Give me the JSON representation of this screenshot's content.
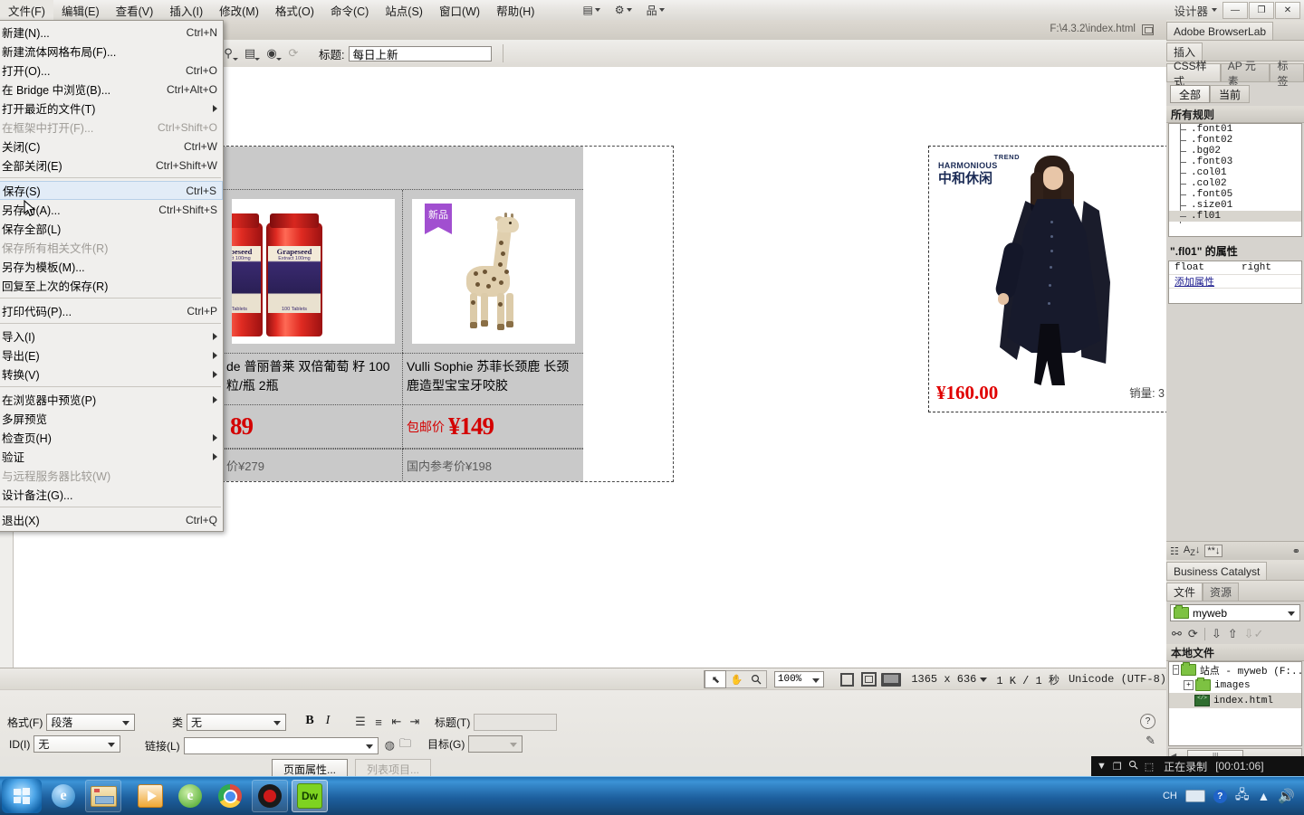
{
  "menubar": {
    "items": [
      {
        "label": "文件(F)",
        "active": true
      },
      {
        "label": "编辑(E)"
      },
      {
        "label": "查看(V)"
      },
      {
        "label": "插入(I)"
      },
      {
        "label": "修改(M)"
      },
      {
        "label": "格式(O)"
      },
      {
        "label": "命令(C)"
      },
      {
        "label": "站点(S)"
      },
      {
        "label": "窗口(W)"
      },
      {
        "label": "帮助(H)"
      }
    ],
    "layout_icon": "▤",
    "settings_icon": "⚙",
    "extend_icon": "品",
    "workspace_label": "设计器",
    "win_minimize": "—",
    "win_restore": "❐",
    "win_close": "✕"
  },
  "file_menu": {
    "items": [
      {
        "label": "新建(N)...",
        "shortcut": "Ctrl+N"
      },
      {
        "label": "新建流体网格布局(F)...",
        "shortcut": ""
      },
      {
        "label": "打开(O)...",
        "shortcut": "Ctrl+O"
      },
      {
        "label": "在 Bridge 中浏览(B)...",
        "shortcut": "Ctrl+Alt+O"
      },
      {
        "label": "打开最近的文件(T)",
        "shortcut": "",
        "submenu": true
      },
      {
        "label": "在框架中打开(F)...",
        "shortcut": "Ctrl+Shift+O",
        "disabled": true
      },
      {
        "label": "关闭(C)",
        "shortcut": "Ctrl+W"
      },
      {
        "label": "全部关闭(E)",
        "shortcut": "Ctrl+Shift+W"
      },
      {
        "separator": true
      },
      {
        "label": "保存(S)",
        "shortcut": "Ctrl+S",
        "highlight": true
      },
      {
        "label": "另存为(A)...",
        "shortcut": "Ctrl+Shift+S"
      },
      {
        "label": "保存全部(L)",
        "shortcut": ""
      },
      {
        "label": "保存所有相关文件(R)",
        "shortcut": "",
        "disabled": true
      },
      {
        "label": "另存为模板(M)...",
        "shortcut": ""
      },
      {
        "label": "回复至上次的保存(R)",
        "shortcut": ""
      },
      {
        "separator": true
      },
      {
        "label": "打印代码(P)...",
        "shortcut": "Ctrl+P"
      },
      {
        "separator": true
      },
      {
        "label": "导入(I)",
        "shortcut": "",
        "submenu": true
      },
      {
        "label": "导出(E)",
        "shortcut": "",
        "submenu": true
      },
      {
        "label": "转换(V)",
        "shortcut": "",
        "submenu": true
      },
      {
        "separator": true
      },
      {
        "label": "在浏览器中预览(P)",
        "shortcut": "",
        "submenu": true
      },
      {
        "label": "多屏预览",
        "shortcut": ""
      },
      {
        "label": "检查页(H)",
        "shortcut": "",
        "submenu": true
      },
      {
        "label": "验证",
        "shortcut": "",
        "submenu": true
      },
      {
        "label": "与远程服务器比较(W)",
        "shortcut": "",
        "disabled": true
      },
      {
        "label": "设计备注(G)...",
        "shortcut": ""
      },
      {
        "separator": true
      },
      {
        "label": "退出(X)",
        "shortcut": "Ctrl+Q"
      }
    ]
  },
  "document": {
    "file_path": "F:\\4.3.2\\index.html",
    "toolbar": {
      "title_label": "标题:",
      "title_value": "每日上新",
      "buttons": [
        "code-nav-icon",
        "visual-aids-icon",
        "live-view-icon",
        "refresh-icon"
      ]
    }
  },
  "page": {
    "products": [
      {
        "badge": "",
        "title": "de 普丽普莱 双倍葡萄\n籽 100粒/瓶 2瓶",
        "ship_label": "",
        "price": "89",
        "ref_price": "价¥279",
        "image": "grapeseed-bottles"
      },
      {
        "badge": "新品",
        "title": "Vulli Sophie 苏菲长颈鹿 长颈鹿造型宝宝牙咬胶",
        "ship_label": "包邮价",
        "price": "¥149",
        "ref_price": "国内参考价¥198",
        "image": "sophie-giraffe"
      }
    ],
    "dress_card": {
      "brand_en_top": "TREND",
      "brand_en_mid": "HARMONIOUS",
      "brand_cn": "中和休闲",
      "price": "¥160.00",
      "sales": "销量: 3"
    }
  },
  "statusbar": {
    "select_icon": "⬉",
    "hand_icon": "✋",
    "zoom_icon": "🔍",
    "zoom_value": "100%",
    "view_small": "view-small-icon",
    "view_medium": "view-medium-icon",
    "view_large": "view-large-icon",
    "dimensions": "1365 x 636",
    "weight": "1 K / 1 秒",
    "encoding": "Unicode (UTF-8)"
  },
  "properties": {
    "format_label": "格式(F)",
    "format_value": "段落",
    "id_label": "ID(I)",
    "id_value": "无",
    "class_label": "类",
    "class_value": "无",
    "link_label": "链接(L)",
    "link_value": "",
    "bold": "B",
    "italic": "I",
    "list_ul": "☰",
    "list_ol": "≡",
    "outdent": "⇤",
    "indent": "⇥",
    "title_label": "标题(T)",
    "title_value": "",
    "target_label": "目标(G)",
    "target_value": "",
    "page_props_button": "页面属性...",
    "list_item_button": "列表项目...",
    "help_icon": "?",
    "edit_icon": "✎"
  },
  "right_panel": {
    "browserlab_tab": "Adobe BrowserLab",
    "insert_tab": "插入",
    "tabs": [
      {
        "label": "CSS样式",
        "active": true
      },
      {
        "label": "AP 元素",
        "active": false
      },
      {
        "label": "标签",
        "active": false
      }
    ],
    "segments": [
      {
        "label": "全部",
        "active": true
      },
      {
        "label": "当前",
        "active": false
      }
    ],
    "rules_header": "所有规则",
    "rules": [
      ".font01",
      ".font02",
      ".bg02",
      ".font03",
      ".col01",
      ".col02",
      ".font05",
      ".size01",
      ".fl01"
    ],
    "selected_rule": ".fl01",
    "props_header": "\".fl01\" 的属性",
    "prop_rows": [
      {
        "key": "float",
        "value": "right"
      }
    ],
    "add_property": "添加属性",
    "icon_bar": [
      "category-view-icon",
      "az-sort-icon",
      "set-props-icon",
      "link-icon"
    ],
    "catalyst_tab": "Business Catalyst",
    "files_tabs": [
      {
        "label": "文件",
        "active": true
      },
      {
        "label": "资源",
        "active": false
      }
    ],
    "site_select": "myweb",
    "file_toolbar": [
      "connect-icon",
      "refresh-icon",
      "get-icon",
      "put-icon",
      "checkin-icon"
    ],
    "local_files_header": "本地文件",
    "file_tree": [
      {
        "label": "站点 - myweb (F:..",
        "type": "folder",
        "depth": 0,
        "expander": "−"
      },
      {
        "label": "images",
        "type": "folder",
        "depth": 1,
        "expander": "+"
      },
      {
        "label": "index.html",
        "type": "html",
        "depth": 2,
        "expander": ""
      }
    ]
  },
  "recording": {
    "collapse_icon": "▼",
    "restore_icon": "❐",
    "zoom_icon": "🔍",
    "crop_icon": "⬚",
    "status": "正在录制",
    "time": "[00:01:06]"
  },
  "taskbar": {
    "start_label": "start-orb",
    "buttons": [
      {
        "name": "ie-quicklaunch",
        "icon": "ie-icon"
      },
      {
        "name": "explorer",
        "icon": "explorer-icon"
      },
      {
        "name": "media-player",
        "icon": "wmp-icon"
      },
      {
        "name": "browser-360",
        "icon": "edge-icon"
      },
      {
        "name": "chrome",
        "icon": "chrome-icon"
      },
      {
        "name": "camtasia-recorder",
        "icon": "record-icon"
      },
      {
        "name": "dreamweaver",
        "icon": "dw-icon"
      }
    ],
    "tray": {
      "ime": "CH",
      "keyboard_icon": "keyboard-icon",
      "help_icon": "?",
      "network_icon": "network-icon",
      "show_hidden_icon": "▲",
      "volume_icon": "🔊"
    }
  },
  "colors": {
    "accent_red": "#d40000",
    "badge_purple": "#a14fd0",
    "taskbar_blue": "#1f6fb5",
    "panel_gray": "#d6d3ce"
  }
}
